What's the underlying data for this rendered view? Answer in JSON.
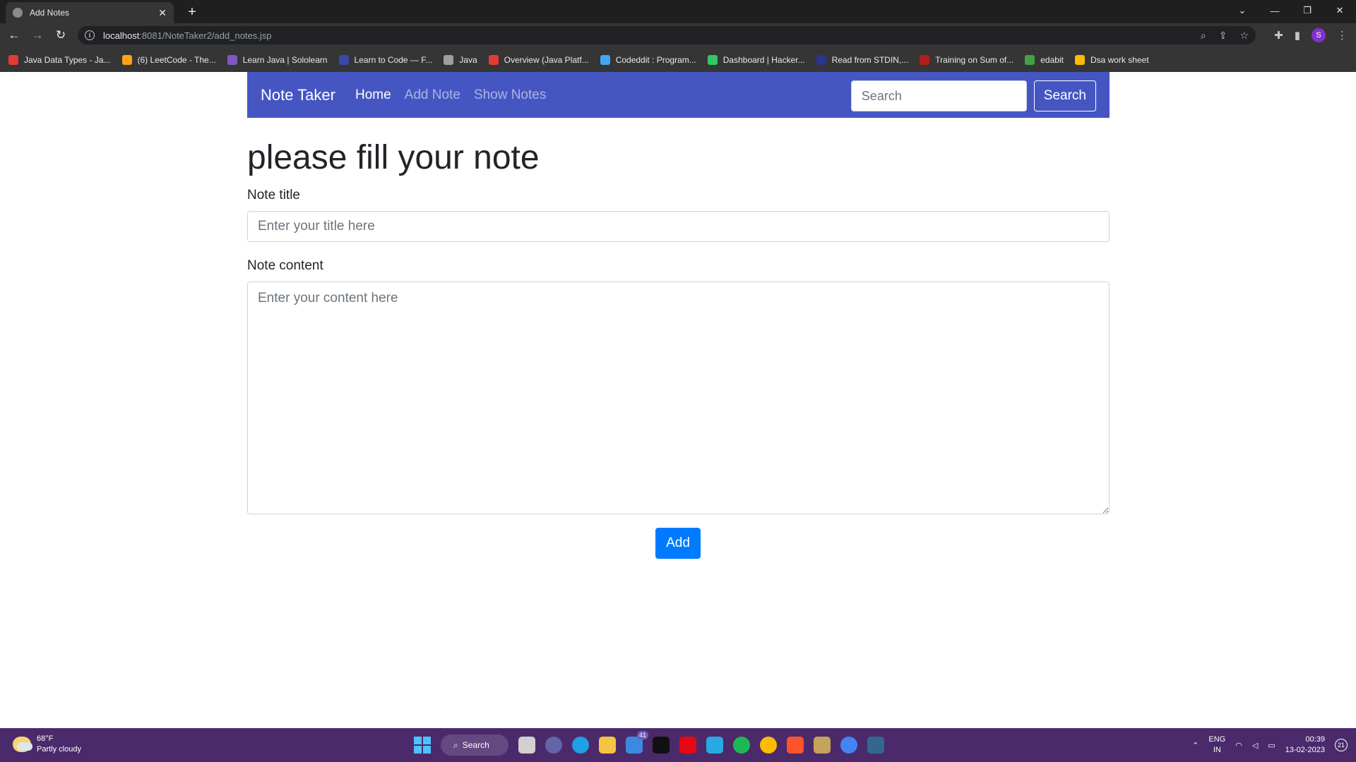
{
  "browser": {
    "tab_title": "Add Notes",
    "tab_close": "✕",
    "new_tab": "+",
    "url_host": "localhost",
    "url_path": ":8081/NoteTaker2/add_notes.jsp",
    "profile_initial": "S",
    "window_controls": [
      "⌄",
      "—",
      "❐",
      "✕"
    ]
  },
  "bookmarks": [
    {
      "label": "Java Data Types - Ja...",
      "color": "#e53935"
    },
    {
      "label": "(6) LeetCode - The...",
      "color": "#ffa116"
    },
    {
      "label": "Learn Java | Sololearn",
      "color": "#7e57c2"
    },
    {
      "label": "Learn to Code — F...",
      "color": "#3949ab"
    },
    {
      "label": "Java",
      "color": "#9e9e9e"
    },
    {
      "label": "Overview (Java Platf...",
      "color": "#e53935"
    },
    {
      "label": "Codeddit : Program...",
      "color": "#42a5f5"
    },
    {
      "label": "Dashboard | Hacker...",
      "color": "#2ec866"
    },
    {
      "label": "Read from STDIN,...",
      "color": "#283593"
    },
    {
      "label": "Training on Sum of...",
      "color": "#b71c1c"
    },
    {
      "label": "edabit",
      "color": "#43a047"
    },
    {
      "label": "Dsa work sheet",
      "color": "#fbbc04"
    }
  ],
  "navbar": {
    "brand": "Note Taker",
    "links": [
      "Home",
      "Add Note",
      "Show Notes"
    ],
    "search_placeholder": "Search",
    "search_button": "Search"
  },
  "form": {
    "heading": "please fill your note",
    "title_label": "Note title",
    "title_placeholder": "Enter your title here",
    "content_label": "Note content",
    "content_placeholder": "Enter your content here",
    "add_button": "Add"
  },
  "taskbar": {
    "weather_temp": "68°F",
    "weather_desc": "Partly cloudy",
    "search_label": "Search",
    "mail_badge": "41",
    "lang_top": "ENG",
    "lang_bottom": "IN",
    "time": "00:39",
    "date": "13-02-2023",
    "notifications": "21"
  }
}
